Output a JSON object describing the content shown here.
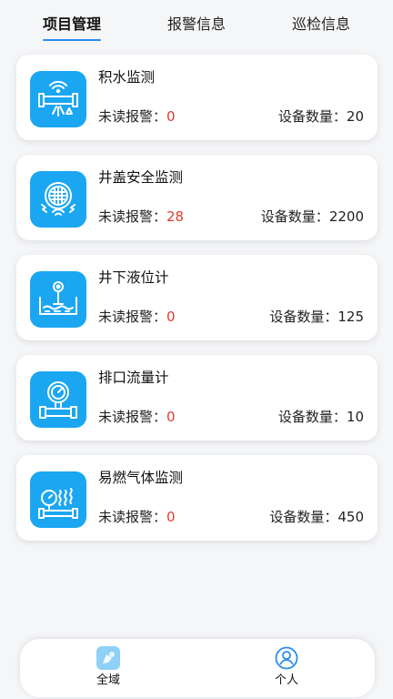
{
  "tabs": [
    {
      "label": "项目管理",
      "active": true
    },
    {
      "label": "报警信息",
      "active": false
    },
    {
      "label": "巡检信息",
      "active": false
    }
  ],
  "alarm_label": "未读报警：",
  "device_label": "设备数量：",
  "cards": [
    {
      "title": "积水监测",
      "unread_alarms": "0",
      "device_count": "20",
      "icon": "waterlogging-pipe-icon"
    },
    {
      "title": "井盖安全监测",
      "unread_alarms": "28",
      "device_count": "2200",
      "icon": "manhole-cover-icon"
    },
    {
      "title": "井下液位计",
      "unread_alarms": "0",
      "device_count": "125",
      "icon": "liquid-level-icon"
    },
    {
      "title": "排口流量计",
      "unread_alarms": "0",
      "device_count": "10",
      "icon": "flow-meter-icon"
    },
    {
      "title": "易燃气体监测",
      "unread_alarms": "0",
      "device_count": "450",
      "icon": "gas-detector-icon"
    }
  ],
  "bottom_nav": [
    {
      "label": "全域",
      "active": true,
      "icon": "region-icon"
    },
    {
      "label": "个人",
      "active": false,
      "icon": "person-icon"
    }
  ],
  "colors": {
    "accent": "#2a8cf0",
    "icon_bg": "#1ba6f2",
    "alarm_number": "#e03a2e",
    "background": "#f5f6f8"
  }
}
